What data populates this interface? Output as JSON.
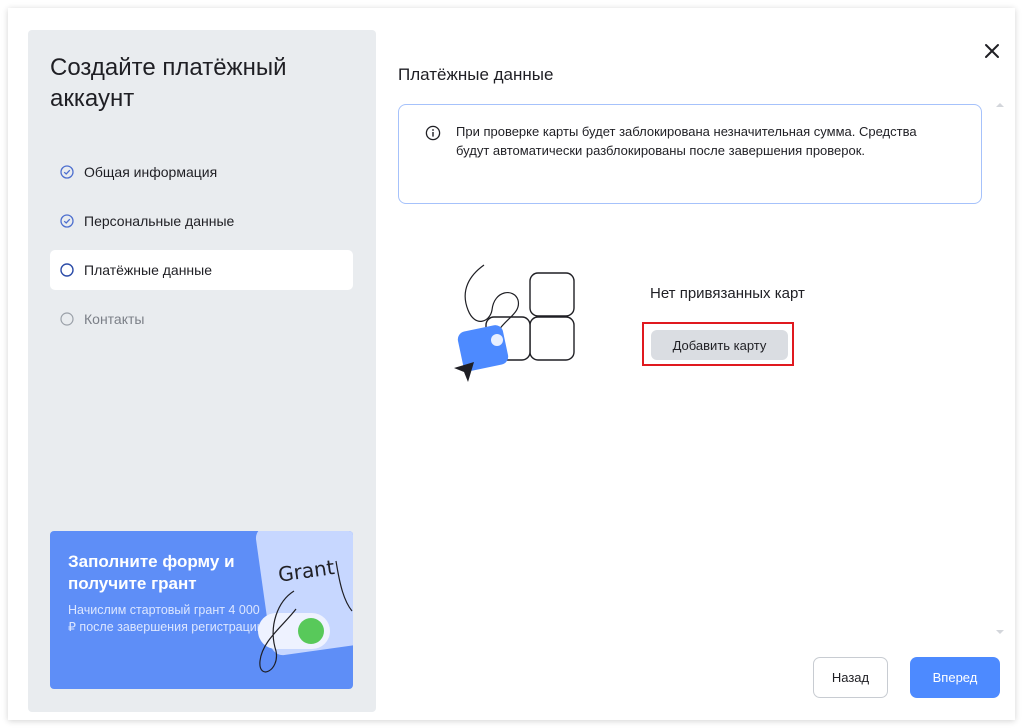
{
  "sidebar": {
    "title": "Создайте платёжный аккаунт",
    "steps": [
      {
        "label": "Общая информация",
        "state": "done"
      },
      {
        "label": "Персональные данные",
        "state": "done"
      },
      {
        "label": "Платёжные данные",
        "state": "active"
      },
      {
        "label": "Контакты",
        "state": "pending"
      }
    ],
    "promo": {
      "title": "Заполните форму и получите грант",
      "text": "Начислим стартовый грант 4 000 ₽ после завершения регистрации",
      "art_label": "Grant"
    }
  },
  "main": {
    "section_title": "Платёжные данные",
    "info_text": "При проверке карты будет заблокирована незначительная сумма. Средства будут автоматически разблокированы после завершения проверок.",
    "empty_state_text": "Нет привязанных карт",
    "add_card_label": "Добавить карту"
  },
  "footer": {
    "back_label": "Назад",
    "next_label": "Вперед"
  },
  "colors": {
    "accent": "#4d8aff",
    "promo_bg": "#5e8ef7",
    "panel_bg": "#e9ecef",
    "info_border": "#a6c2fb",
    "highlight": "#e0191f"
  },
  "icons": {
    "close": "close-icon",
    "info": "info-icon",
    "step_done": "check-circle-icon",
    "step_pending": "empty-circle-icon"
  }
}
